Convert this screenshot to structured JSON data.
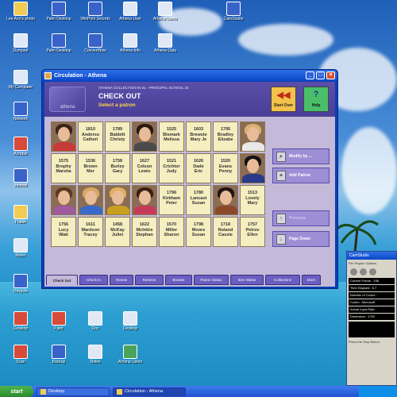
{
  "desktop": {
    "icons": [
      {
        "label": "Lee Ann's photo"
      },
      {
        "label": "Palm Desktop"
      },
      {
        "label": "WinPrint Secrets"
      },
      {
        "label": "Athena User"
      },
      {
        "label": "Athena Users"
      },
      {
        "label": "CamStudio"
      },
      {
        "label": "Dumped"
      },
      {
        "label": "Palm Desktop"
      },
      {
        "label": "ConvertNow"
      },
      {
        "label": "Athena Info"
      },
      {
        "label": "Athena Data"
      },
      {
        "label": "My Computer"
      },
      {
        "label": "Network"
      },
      {
        "label": "Acrobat"
      },
      {
        "label": "Internet"
      },
      {
        "label": "Folder"
      },
      {
        "label": "Notes"
      },
      {
        "label": "Recycle"
      },
      {
        "label": "Desktop"
      },
      {
        "label": "Paint"
      },
      {
        "label": "Doc"
      },
      {
        "label": "Desktop"
      },
      {
        "label": "Scan"
      },
      {
        "label": "Backup"
      },
      {
        "label": "Notes"
      },
      {
        "label": "Athena Users"
      }
    ]
  },
  "window": {
    "title": "Circulation - Athena",
    "header": {
      "subtitle_small": "ATHENA COLLECTION IN EL - PRINCIPAL SCHOOL 34",
      "title": "CHECK OUT",
      "prompt": "Select a patron",
      "logo_text": "athena",
      "start_over_label": "Start Over",
      "help_label": "Help"
    },
    "patrons": [
      {
        "type": "photo",
        "name": "Patron 1",
        "hair": "#3a2518",
        "shirt": "#c83a3a"
      },
      {
        "type": "text",
        "line1": "1810",
        "line2": "Anderso",
        "line3": "Catheri"
      },
      {
        "type": "text",
        "line1": "1789",
        "line2": "Babbitt",
        "line3": "Christy"
      },
      {
        "type": "photo",
        "name": "Patron 4",
        "hair": "#2a1a10",
        "shirt": "#4a4a4a"
      },
      {
        "type": "text",
        "line1": "1525",
        "line2": "Bismark",
        "line3": "Melissa"
      },
      {
        "type": "text",
        "line1": "1603",
        "line2": "Brewste",
        "line3": "Mary Je"
      },
      {
        "type": "text",
        "line1": "1795",
        "line2": "Bradley",
        "line3": "Elizabe"
      },
      {
        "type": "photo",
        "name": "Patron 8",
        "hair": "#d8b070",
        "shirt": "#e8e8e8"
      },
      {
        "type": "text",
        "line1": "1575",
        "line2": "Brophy",
        "line3": "Marsha"
      },
      {
        "type": "text",
        "line1": "1536",
        "line2": "Brown",
        "line3": "Mer"
      },
      {
        "type": "text",
        "line1": "1758",
        "line2": "Burley",
        "line3": "Gary"
      },
      {
        "type": "text",
        "line1": "1627",
        "line2": "Colson",
        "line3": "Lewis"
      },
      {
        "type": "text",
        "line1": "1521",
        "line2": "Crichtor",
        "line3": "Judy"
      },
      {
        "type": "text",
        "line1": "1626",
        "line2": "Dade",
        "line3": "Eric"
      },
      {
        "type": "text",
        "line1": "1520",
        "line2": "Evans",
        "line3": "Penny"
      },
      {
        "type": "photo",
        "name": "Patron 16",
        "hair": "#111111",
        "shirt": "#2a3a8a"
      },
      {
        "type": "photo",
        "name": "Patron 17",
        "hair": "#5a3a20",
        "shirt": "#a05aa0"
      },
      {
        "type": "photo",
        "name": "Patron 18",
        "hair": "#d8a860",
        "shirt": "#3a6ac8"
      },
      {
        "type": "photo",
        "name": "Patron 19",
        "hair": "#e0b060",
        "shirt": "#c8a020"
      },
      {
        "type": "photo",
        "name": "Patron 20",
        "hair": "#3a2010",
        "shirt": "#c83a5a"
      },
      {
        "type": "text",
        "line1": "1796",
        "line2": "Kirkham",
        "line3": "Peter"
      },
      {
        "type": "text",
        "line1": "1780",
        "line2": "Lancast",
        "line3": "Susan"
      },
      {
        "type": "photo",
        "name": "Patron 23",
        "hair": "#201410",
        "shirt": "#8a4a2a"
      },
      {
        "type": "text",
        "line1": "1513",
        "line2": "Lovely",
        "line3": "Mary"
      },
      {
        "type": "text",
        "line1": "1756",
        "line2": "Lucy",
        "line3": "Watt"
      },
      {
        "type": "text",
        "line1": "1611",
        "line2": "Mardson",
        "line3": "Tracey"
      },
      {
        "type": "text",
        "line1": "1458",
        "line2": "McKay",
        "line3": "Juliet"
      },
      {
        "type": "text",
        "line1": "1622",
        "line2": "McIntire",
        "line3": "Stephan"
      },
      {
        "type": "text",
        "line1": "1570",
        "line2": "Miller",
        "line3": "Sharon"
      },
      {
        "type": "text",
        "line1": "1798",
        "line2": "Moore",
        "line3": "Susan"
      },
      {
        "type": "text",
        "line1": "1718",
        "line2": "Noland",
        "line3": "Cassie"
      },
      {
        "type": "text",
        "line1": "1757",
        "line2": "Petrov",
        "line3": "Ellen"
      }
    ],
    "actions": {
      "modify": "Modify by ...",
      "add_patron": "Add Patron",
      "previous": "Previous",
      "page_down": "Page Down"
    },
    "tabs": [
      {
        "label": "Check Out",
        "active": true
      },
      {
        "label": "Check In",
        "active": false
      },
      {
        "label": "Renew",
        "active": false
      },
      {
        "label": "Reserve",
        "active": false
      },
      {
        "label": "Browse",
        "active": false
      },
      {
        "label": "Patron Status",
        "active": false
      },
      {
        "label": "Item Status",
        "active": false
      },
      {
        "label": "Collections",
        "active": false
      },
      {
        "label": "More",
        "active": false
      }
    ]
  },
  "camstudio_panel": {
    "title": "CamStudio",
    "menu": "File  Region  Options",
    "rows": [
      "Current Frame : 196",
      "Time Elapsed : 6.7",
      "Number of Colors :",
      "Codec : Microsoft",
      "Actual Input Rate :",
      "Dimension : 1792"
    ],
    "footer": "Press the Stop Button"
  },
  "taskbar": {
    "start": "start",
    "items": [
      {
        "label": "Desktop",
        "active": false
      },
      {
        "label": "Circulation - Athena",
        "active": true
      }
    ]
  }
}
